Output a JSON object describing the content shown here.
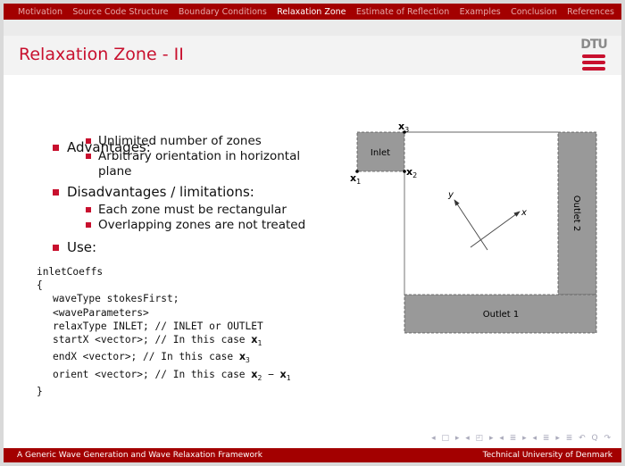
{
  "nav": {
    "items": [
      "Motivation",
      "Source Code Structure",
      "Boundary Conditions",
      "Relaxation Zone",
      "Estimate of Reflection",
      "Examples",
      "Conclusion",
      "References"
    ],
    "active": "Relaxation Zone"
  },
  "title": "Relaxation Zone - II",
  "logo": {
    "text": "DTU"
  },
  "bullets": {
    "advantages": "Advantages:",
    "adv_items": [
      "Unlimited number of zones",
      "Arbitrary orientation in horizontal plane"
    ],
    "disadvantages": "Disadvantages / limitations:",
    "dis_items": [
      "Each zone must be rectangular",
      "Overlapping zones are not treated"
    ],
    "use": "Use:"
  },
  "code": {
    "l1": "inletCoeffs",
    "l2": "{",
    "l3": "waveType stokesFirst;",
    "l4": "<waveParameters>",
    "l5": "relaxType INLET; // INLET or OUTLET",
    "l6": "startX <vector>; // In this case ",
    "l7": "endX <vector>; // In this case ",
    "l8": "orient <vector>; // In this case ",
    "l9": "}",
    "x": "x",
    "s1": "1",
    "s2": "2",
    "s3": "3",
    "minus": " − "
  },
  "diagram": {
    "inlet": "Inlet",
    "outlet1": "Outlet 1",
    "outlet2": "Outlet 2",
    "x_axis": "x",
    "y_axis": "y",
    "pt": "x",
    "p1": "1",
    "p2": "2",
    "p3": "3",
    "zone_color": "#999999"
  },
  "footer": {
    "left": "A Generic Wave Generation and Wave Relaxation Framework",
    "right": "Technical University of Denmark"
  },
  "nav_symbols": "◂ □ ▸ ◂ ◰ ▸ ◂ ≣ ▸ ◂ ≣ ▸   ≣   ↶ Q ↷"
}
